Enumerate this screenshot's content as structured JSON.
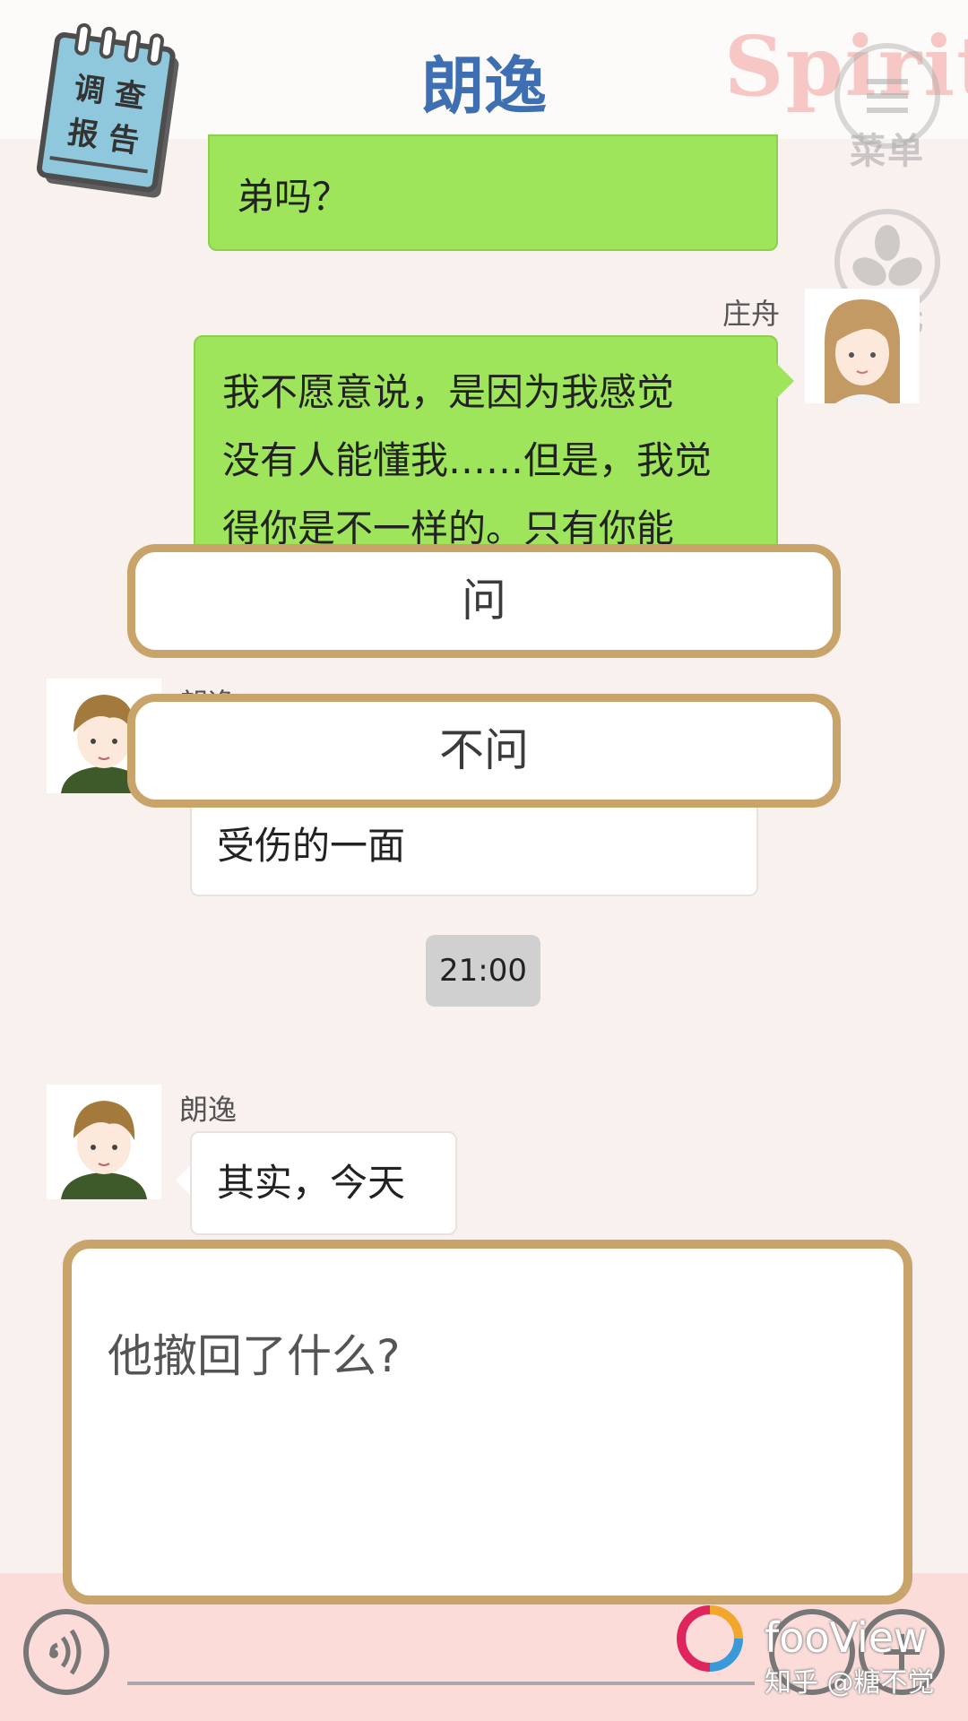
{
  "header": {
    "title": "朗逸",
    "brand": "Spirit"
  },
  "notebook": {
    "line1": "调 查",
    "line2": "报 告"
  },
  "side_buttons": {
    "menu_label": "菜单",
    "light_label": "灯光"
  },
  "messages": {
    "m1_text": "弟吗？",
    "m2_sender": "庄舟",
    "m2_line1": "我不愿意说，是因为我感觉",
    "m2_line2": "没有人能懂我……但是，我觉",
    "m2_line3": "得你是不一样的。只有你能",
    "m3_sender": "朗逸",
    "m3_text": "受伤的一面",
    "time": "21:00",
    "m4_sender": "朗逸",
    "m4_text": "其实，今天"
  },
  "choices": [
    "问",
    "不问"
  ],
  "question": {
    "text": "他撤回了什么?"
  },
  "watermark": {
    "brand": "fooView",
    "sub": "知乎 @糖不觉"
  },
  "colors": {
    "accent": "#3f6fb3",
    "green_bubble": "#9fe55c",
    "choice_border": "#c9a46a",
    "bottom_bar": "#fbdcd9",
    "background": "#f8f1ee"
  }
}
